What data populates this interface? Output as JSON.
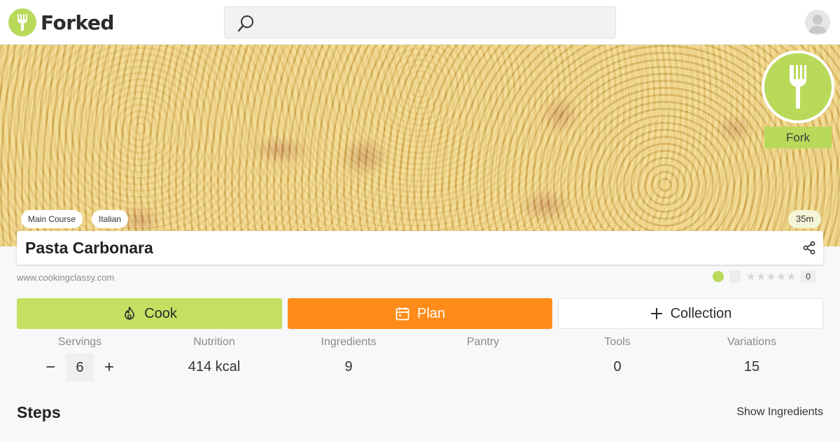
{
  "header": {
    "brand": "Forked",
    "search_placeholder": ""
  },
  "hero": {
    "tags": [
      "Main Course",
      "Italian"
    ],
    "time": "35m",
    "fork_label": "Fork"
  },
  "recipe": {
    "title": "Pasta Carbonara",
    "source": "www.cookingclassy.com",
    "rating_count": "0",
    "stars": "★★★★★"
  },
  "actions": {
    "cook": "Cook",
    "plan": "Plan",
    "collection": "Collection"
  },
  "stats": {
    "servings": {
      "label": "Servings",
      "value": "6",
      "minus": "−",
      "plus": "+"
    },
    "nutrition": {
      "label": "Nutrition",
      "value": "414 kcal"
    },
    "ingredients": {
      "label": "Ingredients",
      "value": "9"
    },
    "pantry": {
      "label": "Pantry",
      "value": ""
    },
    "tools": {
      "label": "Tools",
      "value": "0"
    },
    "variations": {
      "label": "Variations",
      "value": "15"
    }
  },
  "steps": {
    "heading": "Steps",
    "show_ingredients": "Show Ingredients"
  },
  "colors": {
    "brand_green": "#b9d95a",
    "cook_green": "#c5df63",
    "plan_orange": "#ff8c1a"
  }
}
